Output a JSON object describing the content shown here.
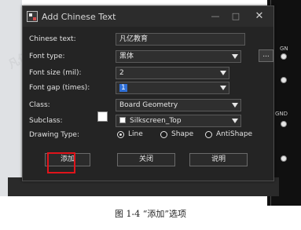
{
  "dialog": {
    "title": "Add Chinese Text",
    "window_buttons": {
      "minimize": "—",
      "maximize": "□",
      "close": "✕"
    },
    "fields": {
      "chinese_text": {
        "label": "Chinese text:",
        "value": "凡亿教育"
      },
      "font_type": {
        "label": "Font type:",
        "value": "黑体"
      },
      "font_size": {
        "label": "Font size (mil):",
        "value": "2"
      },
      "font_gap": {
        "label": "Font gap (times):",
        "value": "1"
      },
      "class": {
        "label": "Class:",
        "value": "Board Geometry"
      },
      "subclass": {
        "label": "Subclass:",
        "value": "Silkscreen_Top"
      }
    },
    "browse_button": "...",
    "drawing_type": {
      "label": "Drawing Type:",
      "options": [
        "Line",
        "Shape",
        "AntiShape"
      ],
      "selected": "Line"
    },
    "buttons": {
      "add": "添加",
      "close": "关闭",
      "help": "说明"
    }
  },
  "background": {
    "pin_labels": [
      "GN",
      "GND"
    ]
  },
  "caption": "图 1-4 “添加”选项",
  "colors": {
    "highlight_box": "#e0141b",
    "selection": "#2f6fd6",
    "dialog_bg": "#242424"
  }
}
